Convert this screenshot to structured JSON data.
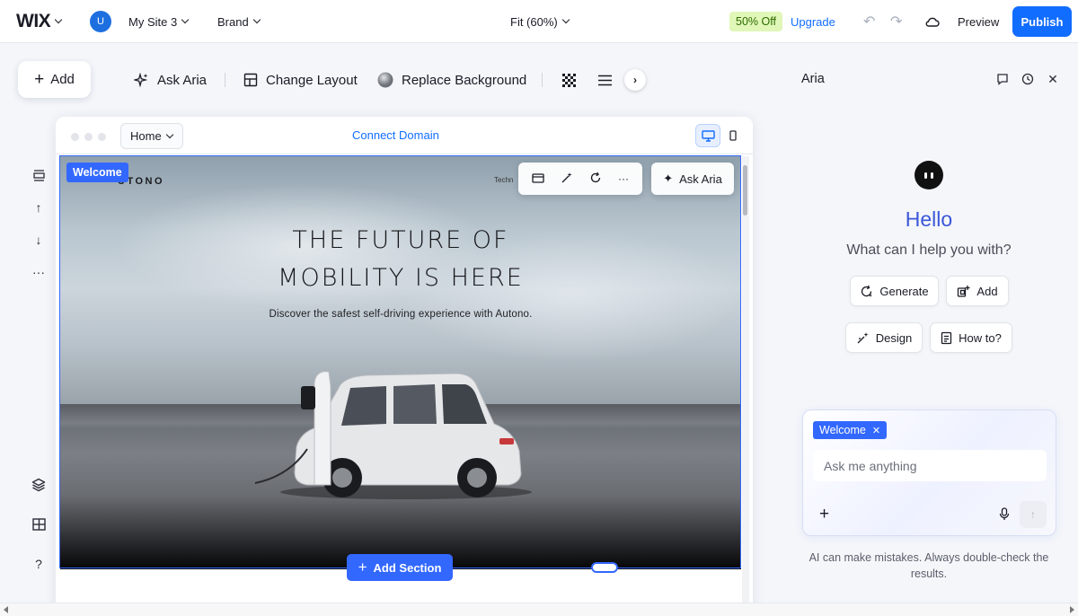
{
  "topbar": {
    "logo": "WIX",
    "avatar_initial": "U",
    "site_name": "My Site 3",
    "brand_label": "Brand",
    "zoom_label": "Fit (60%)",
    "discount_badge": "50% Off",
    "upgrade_label": "Upgrade",
    "preview_label": "Preview",
    "publish_label": "Publish"
  },
  "toolbar": {
    "add_label": "Add",
    "ask_aria_label": "Ask Aria",
    "change_layout_label": "Change Layout",
    "replace_background_label": "Replace Background"
  },
  "frame": {
    "page_selector": "Home",
    "connect_domain_label": "Connect Domain"
  },
  "hero": {
    "brand_text": "UTONO",
    "nav_partial": "Techn",
    "title_line1": "THE FUTURE OF",
    "title_line2": "MOBILITY IS HERE",
    "subtitle": "Discover the safest self-driving experience with Autono.",
    "section_tag": "Welcome",
    "ask_aria_label": "Ask Aria",
    "add_section_label": "Add Section"
  },
  "aria_panel": {
    "title": "Aria",
    "greeting": "Hello",
    "prompt": "What can I help you with?",
    "chips": {
      "generate": "Generate",
      "add": "Add",
      "design": "Design",
      "how_to": "How to?"
    },
    "context_tag": "Welcome",
    "input_placeholder": "Ask me anything",
    "disclaimer": "AI can make mistakes. Always double-check the results."
  },
  "colors": {
    "accent": "#116dff",
    "selection": "#3368ff",
    "badge_bg": "#e0f7b8",
    "aria_heading": "#3c57d8"
  }
}
